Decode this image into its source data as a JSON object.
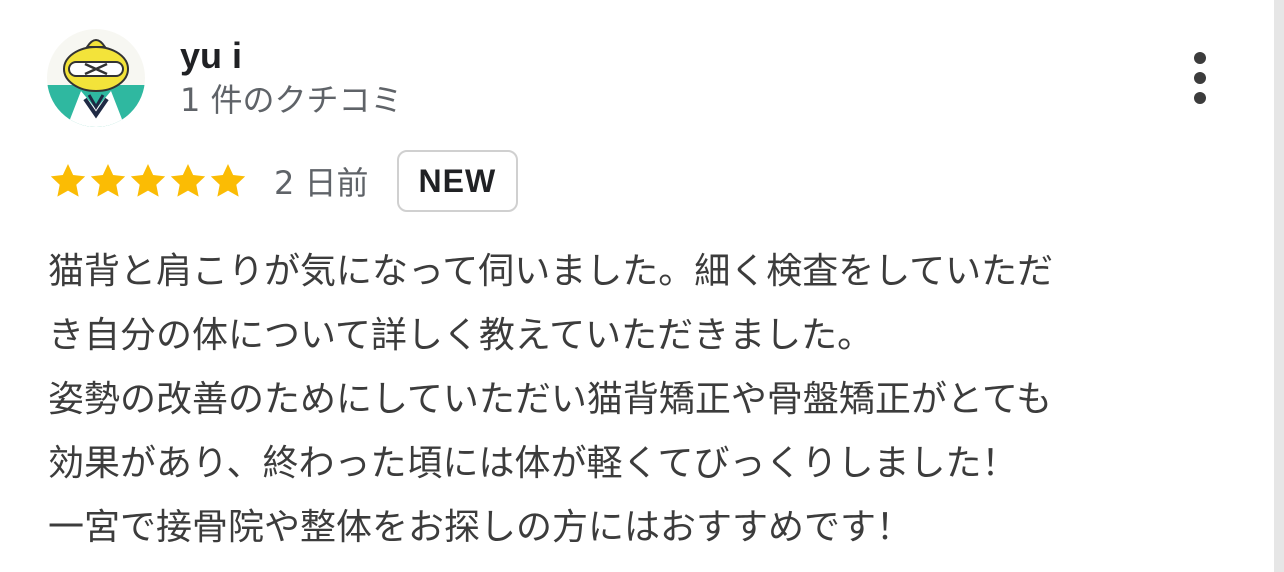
{
  "reviewer": {
    "name": "yu i",
    "review_count": "1 件のクチコミ",
    "avatar_icon": "avatar-icon"
  },
  "menu": {
    "icon": "more-vert-icon"
  },
  "rating": {
    "stars": 5,
    "max_stars": 5,
    "date": "2 日前",
    "badge": "NEW",
    "star_color": "#fbbc04"
  },
  "review": {
    "lines": [
      "猫背と肩こりが気になって伺いました。細く検査をしていただ",
      "き自分の体について詳しく教えていただきました。",
      "姿勢の改善のためにしていただい猫背矯正や骨盤矯正がとても",
      "効果があり、終わった頃には体が軽くてびっくりしました！",
      "一宮で接骨院や整体をお探しの方にはおすすめです！"
    ]
  }
}
